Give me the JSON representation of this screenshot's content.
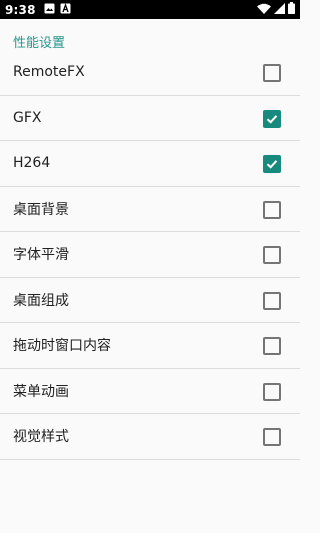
{
  "statusbar": {
    "time": "9:38",
    "left_icons": [
      "image-icon",
      "text-a-icon"
    ],
    "right_icons": [
      "wifi-icon",
      "signal-icon",
      "battery-icon"
    ]
  },
  "section": {
    "title": "性能设置"
  },
  "items": [
    {
      "label": "RemoteFX",
      "checked": false
    },
    {
      "label": "GFX",
      "checked": true
    },
    {
      "label": "H264",
      "checked": true
    },
    {
      "label": "桌面背景",
      "checked": false
    },
    {
      "label": "字体平滑",
      "checked": false
    },
    {
      "label": "桌面组成",
      "checked": false
    },
    {
      "label": "拖动时窗口内容",
      "checked": false
    },
    {
      "label": "菜单动画",
      "checked": false
    },
    {
      "label": "视觉样式",
      "checked": false
    }
  ],
  "colors": {
    "accent": "#178a7d",
    "header_text": "#26968a"
  }
}
